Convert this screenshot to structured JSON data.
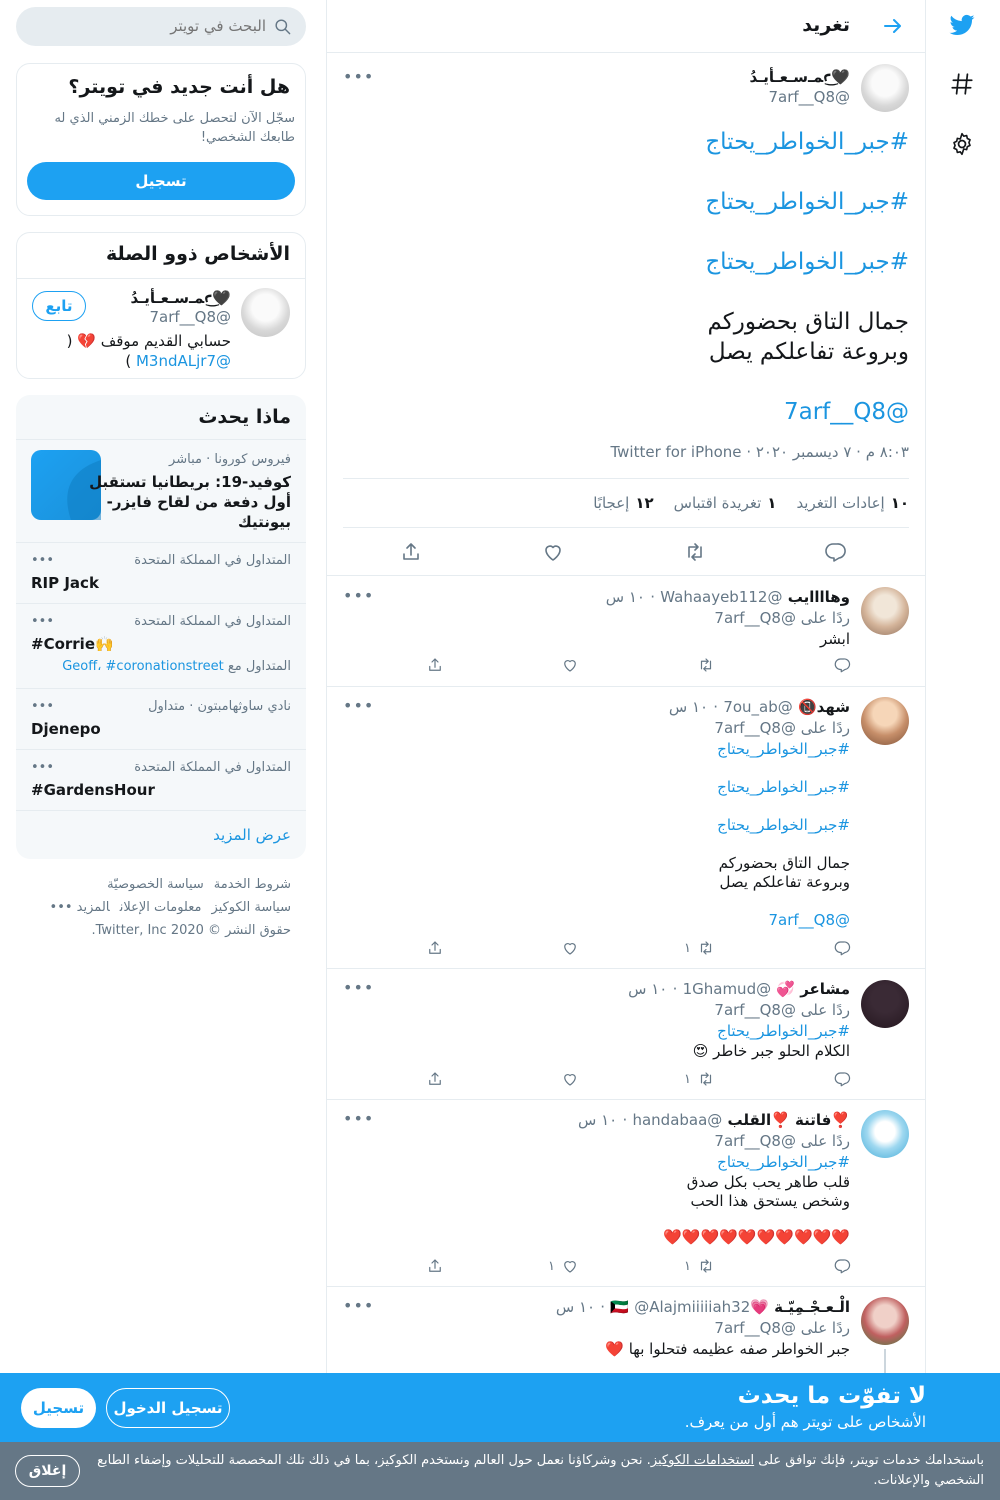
{
  "header": {
    "title": "تغريد"
  },
  "focal_tweet": {
    "name": "🖤ꜥ͜ﻤـﺳـعـأيـدُ",
    "handle": "@7arf__Q8",
    "lines": [
      "#جبر_الخواطر_يحتاج",
      "#جبر_الخواطر_يحتاج",
      "#جبر_الخواطر_يحتاج",
      "جمال التاق بحضوركم",
      " وبروعة تفاعلكم يصل",
      "@7arf__Q8"
    ],
    "meta": "٨:٠٣ م · ٧ ديسمبر ٢٠٢٠ · Twitter for iPhone",
    "retweets_count": "١٠",
    "retweets_label": "إعادات التغريد",
    "quotes_count": "١",
    "quotes_label": "تغريدة اقتباس",
    "likes_count": "١٢",
    "likes_label": "إعجابًا"
  },
  "replies": [
    {
      "name": "وهاااايب",
      "handle": "@Wahaayeb112",
      "time": "١٠ س",
      "reply_to": "ردًا على @7arf__Q8",
      "lines": [
        "ابشر"
      ],
      "retweets": "",
      "likes": ""
    },
    {
      "name": "شهد📵",
      "handle": "@7ou_ab",
      "time": "١٠ س",
      "reply_to": "ردًا على @7arf__Q8",
      "lines": [
        "#جبر_الخواطر_يحتاج",
        "",
        "#جبر_الخواطر_يحتاج",
        "",
        "#جبر_الخواطر_يحتاج",
        "",
        "جمال التاق بحضوركم",
        " وبروعة تفاعلكم يصل",
        "",
        "@7arf__Q8"
      ],
      "retweets": "١",
      "likes": ""
    },
    {
      "name": "مشاعر 💞",
      "handle": "@1Ghamud",
      "time": "١٠ س",
      "reply_to": "ردًا على @7arf__Q8",
      "lines": [
        "#جبر_الخواطر_يحتاج",
        "الكلام الحلو جبر خاطر 😍"
      ],
      "retweets": "١",
      "likes": ""
    },
    {
      "name": "❣️فاتنة ❣️القلب",
      "handle": "@handabaa",
      "time": "١٠ س",
      "reply_to": "ردًا على @7arf__Q8",
      "lines": [
        "#جبر_الخواطر_يحتاج",
        "قلب طاهر يحب بكل صدق",
        "وشخص يستحق هذا الحب",
        "",
        "❤️❤️❤️❤️❤️❤️❤️❤️❤️❤️"
      ],
      "retweets": "١",
      "likes": "١"
    },
    {
      "name": "الْـعـجْـمِيّـة 💗🇰🇼",
      "handle": "@Alajmiiiiiah32",
      "time": "١٠ س",
      "reply_to": "ردًا على @7arf__Q8",
      "lines": [
        "جبر الخواطر صفه عظيمه فتحلوا بها ❤️"
      ],
      "retweets": "",
      "likes": ""
    }
  ],
  "sidebar": {
    "search_placeholder": "البحث في تويتر",
    "new_card": {
      "title": "هل أنت جديد في تويتر؟",
      "line1": "سجّل الآن لتحصل على خطك الزمني الذي له",
      "line2": "طابعك الشخصي!",
      "button": "تسجيل"
    },
    "relevant": {
      "title": "الأشخاص ذوو الصلة",
      "name": "🖤ꜥ͜ﻤـﺳـعـأيـدُ",
      "handle": "@7arf__Q8",
      "follow": "تابع",
      "bio_line1": "حسابي القديم موقف 💔 (",
      "bio_link": "@M3ndALjr7",
      "bio_end": " )"
    },
    "trends": {
      "title": "ماذا يحدث",
      "news_category": "فيروس كورونا · مباشر",
      "news_line1": "كوفيد-19: بريطانيا تستقبل",
      "news_line2": "أول دفعة من لقاح فايزر-",
      "news_line3": "بيونتيك",
      "items": [
        {
          "category": "المتداول في المملكة المتحدة",
          "name": "RIP Jack",
          "with_label": "",
          "with_tags": ""
        },
        {
          "category": "المتداول في المملكة المتحدة",
          "name": "#Corrie🙌",
          "with_label": "المتداول مع",
          "with_tags": "Geoff، #coronationstreet"
        },
        {
          "category": "نادي ساوثهامبتون · متداول",
          "name": "Djenepo",
          "with_label": "",
          "with_tags": ""
        },
        {
          "category": "المتداول في المملكة المتحدة",
          "name": "#GardensHour",
          "with_label": "",
          "with_tags": ""
        }
      ],
      "show_more": "عرض المزيد"
    },
    "footer": {
      "row1": [
        "شروط الخدمة",
        "سياسة الخصوصيّة"
      ],
      "row2": [
        "سياسة الكوكيز",
        "معلومات الإعلان",
        "المزيد •••"
      ],
      "copyright": "حقوق النشر © 2020 Twitter, Inc."
    }
  },
  "signup_bar": {
    "title": "لا تفوّت ما يحدث",
    "subtitle": "الأشخاص على تويتر هم أول من يعرف.",
    "login": "تسجيل الدخول",
    "signup": "تسجيل"
  },
  "cookie_bar": {
    "text_before": "باستخدامك خدمات تويتر، فإنك توافق على ",
    "link": "استخدامات الكوكيز",
    "text_after": ". نحن وشركاؤنا نعمل حول العالم ونستخدم الكوكيز، بما في ذلك تلك المخصصة للتحليلات وإضفاء الطابع",
    "line2": "الشخصي والإعلانات.",
    "close": "إغلاق"
  },
  "colors": {
    "brand": "#1da1f2",
    "link": "#1b95e0",
    "muted": "#657786",
    "cookie_bg": "#657786"
  },
  "icons": [
    "twitter-bird-icon",
    "hashtag-icon",
    "gear-icon",
    "back-arrow-icon",
    "search-icon",
    "more-icon",
    "reply-icon",
    "retweet-icon",
    "like-icon",
    "share-icon"
  ]
}
